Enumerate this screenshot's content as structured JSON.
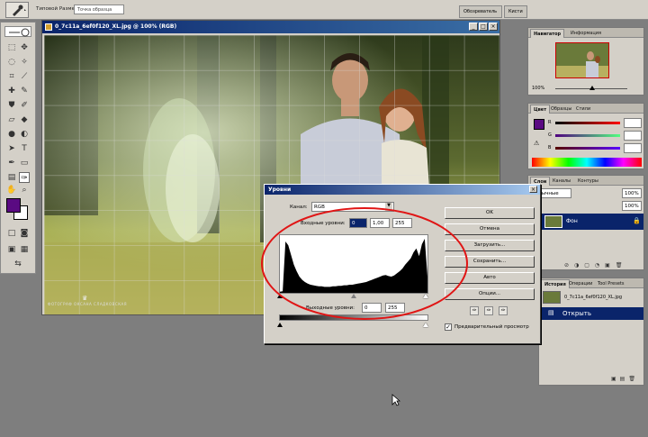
{
  "optbar": {
    "size_label": "Типовой Размер:",
    "size_value": "Точка образца",
    "dock_tabs": [
      "Обозреватель",
      "Кисти"
    ]
  },
  "document": {
    "title": "0_7c11a_6ef0f120_XL.jpg @ 100% (RGB)",
    "watermark": "ФОТОГРАФ  ОКСАНА СЛАДКОВСКАЯ"
  },
  "navigator": {
    "tabs": [
      "Навигатор",
      "Информация"
    ],
    "zoom": "100%"
  },
  "color_panel": {
    "tabs": [
      "Цвет",
      "Образцы",
      "Стили"
    ],
    "channels": [
      "R",
      "G",
      "B"
    ],
    "values": [
      "",
      "",
      ""
    ]
  },
  "layers_panel": {
    "tabs": [
      "Слои",
      "Каналы",
      "Контуры"
    ],
    "blend_mode": "Обычные",
    "opacity": "100%",
    "fill": "100%",
    "layer_name": "Фон"
  },
  "history_panel": {
    "tabs": [
      "История",
      "Операции",
      "Tool Presets"
    ],
    "snapshot": "0_7c11a_6ef0f120_XL.jpg",
    "step": "Открыть"
  },
  "levels": {
    "title": "Уровни",
    "channel_label": "Канал:",
    "channel_value": "RGB",
    "input_label": "Входные уровни:",
    "input_black": "0",
    "input_gamma": "1,00",
    "input_white": "255",
    "output_label": "Выходные уровни:",
    "output_black": "0",
    "output_white": "255",
    "buttons": {
      "ok": "OK",
      "cancel": "Отмена",
      "load": "Загрузить...",
      "save": "Сохранить...",
      "auto": "Авто",
      "options": "Опции..."
    },
    "preview_label": "Предварительный просмотр",
    "preview_checked": true,
    "histogram": [
      2,
      3,
      95,
      88,
      70,
      52,
      40,
      30,
      24,
      20,
      17,
      15,
      14,
      13,
      12,
      12,
      11,
      11,
      11,
      12,
      12,
      13,
      13,
      14,
      14,
      15,
      15,
      16,
      17,
      18,
      19,
      20,
      22,
      24,
      26,
      28,
      30,
      32,
      33,
      31,
      30,
      32,
      36,
      40,
      45,
      52,
      58,
      64,
      75,
      82,
      68,
      90,
      100,
      30
    ]
  },
  "colors": {
    "accent_title": "#0a246a",
    "foreground": "#5a0a82",
    "annotation": "#e01515",
    "selected_row": "#0a246a"
  }
}
